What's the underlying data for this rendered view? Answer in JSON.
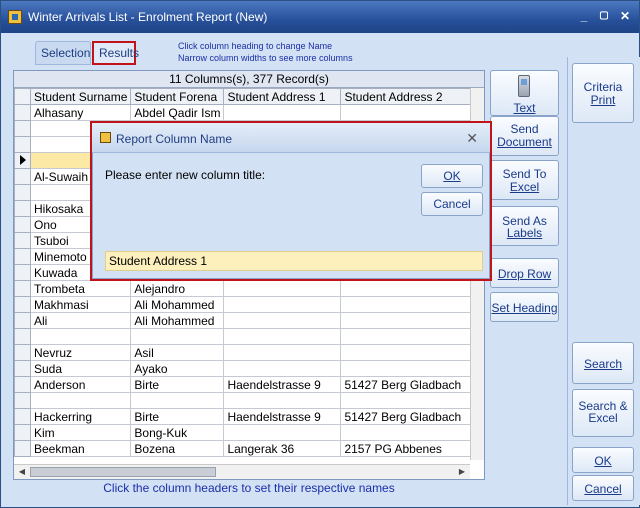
{
  "window": {
    "title": "Winter Arrivals List - Enrolment Report (New)",
    "minimize": "_",
    "maximize": "▢",
    "close": "✕"
  },
  "tabs": {
    "selection": "Selection",
    "results": "Results"
  },
  "hints": {
    "line1": "Click column heading to change Name",
    "line2": "Narrow column widths to see more columns"
  },
  "grid": {
    "caption": "11 Columns(s), 377 Record(s)",
    "columns": [
      "Student Surname",
      "Student Forena",
      "Student Address 1",
      "Student Address 2"
    ],
    "rows": [
      [
        "Alhasany",
        "Abdel Qadir Ism",
        "",
        ""
      ],
      [
        "",
        "",
        "",
        ""
      ],
      [
        "",
        "",
        "",
        ""
      ],
      [
        "",
        "",
        "",
        ""
      ],
      [
        "Al-Suwaih",
        "",
        "",
        ""
      ],
      [
        "",
        "",
        "",
        ""
      ],
      [
        "Hikosaka",
        "",
        "",
        ""
      ],
      [
        "Ono",
        "",
        "",
        ""
      ],
      [
        "Tsuboi",
        "",
        "",
        ""
      ],
      [
        "Minemoto",
        "",
        "",
        ""
      ],
      [
        "Kuwada",
        "",
        "",
        ""
      ],
      [
        "Trombeta",
        "Alejandro",
        "",
        ""
      ],
      [
        "Makhmasi",
        "Ali Mohammed",
        "",
        ""
      ],
      [
        "Ali",
        "Ali Mohammed",
        "",
        ""
      ],
      [
        "",
        "",
        "",
        ""
      ],
      [
        "Nevruz",
        "Asil",
        "",
        ""
      ],
      [
        "Suda",
        "Ayako",
        "",
        ""
      ],
      [
        "Anderson",
        "Birte",
        "Haendelstrasse 9",
        "51427 Berg Gladbach"
      ],
      [
        "",
        "",
        "",
        ""
      ],
      [
        "Hackerring",
        "Birte",
        "Haendelstrasse 9",
        "51427 Berg Gladbach"
      ],
      [
        "Kim",
        "Bong-Kuk",
        "",
        ""
      ],
      [
        "Beekman",
        "Bozena",
        "Langerak 36",
        "2157 PG Abbenes"
      ]
    ],
    "current_row_index": 3,
    "footer": "Click the column headers to set their respective names"
  },
  "side_buttons": {
    "text": "Text",
    "send_document_1": "Send",
    "send_document_2": "Document",
    "send_excel_1": "Send To",
    "send_excel_2": "Excel",
    "send_labels_1": "Send As",
    "send_labels_2": "Labels",
    "drop_row": "Drop Row",
    "set_heading": "Set Heading"
  },
  "right_buttons": {
    "criteria_1": "Criteria",
    "criteria_2": "Print",
    "search": "Search",
    "search_excel_1": "Search &",
    "search_excel_2": "Excel",
    "ok": "OK",
    "cancel": "Cancel"
  },
  "dialog": {
    "title": "Report Column Name",
    "close": "✕",
    "prompt": "Please enter new column title:",
    "ok": "OK",
    "cancel": "Cancel",
    "input_value": "Student Address 1"
  }
}
